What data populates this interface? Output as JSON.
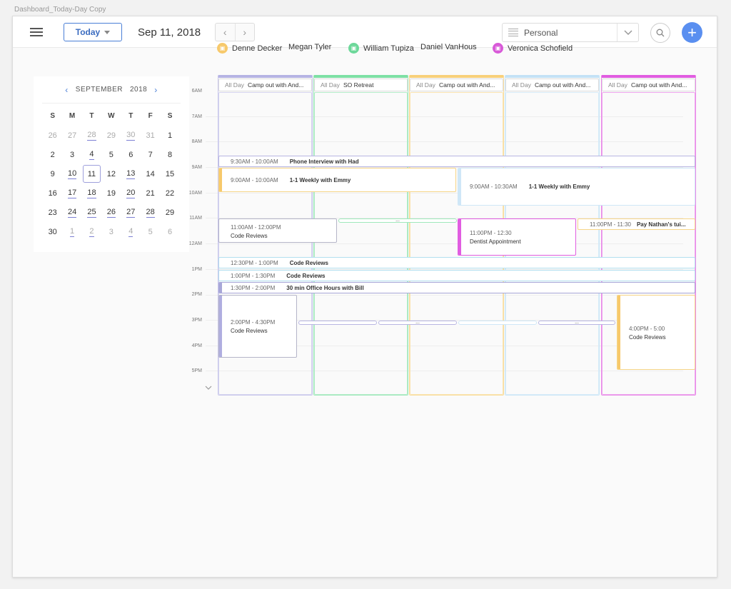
{
  "doc_title": "Dashboard_Today-Day Copy",
  "header": {
    "today_label": "Today",
    "date_label": "Sep 11, 2018",
    "calendar_select": "Personal",
    "add_label": "+"
  },
  "mini_calendar": {
    "month": "SEPTEMBER",
    "year": "2018",
    "weekdays": [
      "S",
      "M",
      "T",
      "W",
      "T",
      "F",
      "S"
    ],
    "weeks": [
      [
        "26",
        "27",
        "28",
        "29",
        "30",
        "31",
        "1"
      ],
      [
        "2",
        "3",
        "4",
        "5",
        "6",
        "7",
        "8"
      ],
      [
        "9",
        "10",
        "11",
        "12",
        "13",
        "14",
        "15"
      ],
      [
        "16",
        "17",
        "18",
        "19",
        "20",
        "21",
        "22"
      ],
      [
        "23",
        "24",
        "25",
        "26",
        "27",
        "28",
        "29"
      ],
      [
        "30",
        "1",
        "2",
        "3",
        "4",
        "5",
        "6"
      ]
    ]
  },
  "people": [
    {
      "name": "Denne Decker",
      "color": "#f7c96b"
    },
    {
      "name": "Megan Tyler",
      "color": ""
    },
    {
      "name": "William Tupiza",
      "color": "#6dd89a"
    },
    {
      "name": "Daniel VanHous",
      "color": ""
    },
    {
      "name": "Veronica Schofield",
      "color": "#d85ad8"
    }
  ],
  "columns": [
    {
      "color": "#b6b4e4",
      "inner": "#c9c7ec",
      "allday_label": "All Day",
      "allday_title": "Camp out with And..."
    },
    {
      "color": "#7ee0a4",
      "inner": "#9fe8bb",
      "allday_label": "All Day",
      "allday_title": "SO Retreat"
    },
    {
      "color": "#f8d07a",
      "inner": "#f8dc9c",
      "allday_label": "All Day",
      "allday_title": "Camp out with And..."
    },
    {
      "color": "#c4e2f6",
      "inner": "#cbe6f7",
      "allday_label": "All Day",
      "allday_title": "Camp out with And..."
    },
    {
      "color": "#e15de1",
      "inner": "#e88ae8",
      "allday_label": "All Day",
      "allday_title": "Camp out with And..."
    }
  ],
  "times": [
    "6AM",
    "7AM",
    "8AM",
    "9AM",
    "10AM",
    "11AM",
    "12AM",
    "1PM",
    "2PM",
    "3PM",
    "4PM",
    "5PM"
  ],
  "events": {
    "phone_interview": {
      "time": "9:30AM - 10:00AM",
      "title": "Phone Interview with Had"
    },
    "weekly_emmy_a": {
      "time": "9:00AM - 10:00AM",
      "title": "1-1 Weekly with Emmy"
    },
    "weekly_emmy_b": {
      "time": "9:00AM - 10:30AM",
      "title": "1-1 Weekly with Emmy"
    },
    "code_reviews_11": {
      "time": "11:00AM - 12:00PM",
      "title": "Code Reviews"
    },
    "dentist": {
      "time": "11:00PM - 12:30",
      "title": "Dentist Appointment"
    },
    "pay_nathan": {
      "time": "11:00PM - 11:30",
      "title": "Pay Nathan's tui..."
    },
    "code_reviews_1230": {
      "time": "12:30PM - 1:00PM",
      "title": "Code Reviews"
    },
    "code_reviews_1": {
      "time": "1:00PM - 1:30PM",
      "title": "Code Reviews"
    },
    "office_hours": {
      "time": "1:30PM - 2:00PM",
      "title": "30 min Office Hours with Bill"
    },
    "code_reviews_2": {
      "time": "2:00PM - 4:30PM",
      "title": "Code Reviews"
    },
    "code_reviews_4": {
      "time": "4:00PM - 5:00",
      "title": "Code Reviews"
    },
    "more": "..."
  }
}
